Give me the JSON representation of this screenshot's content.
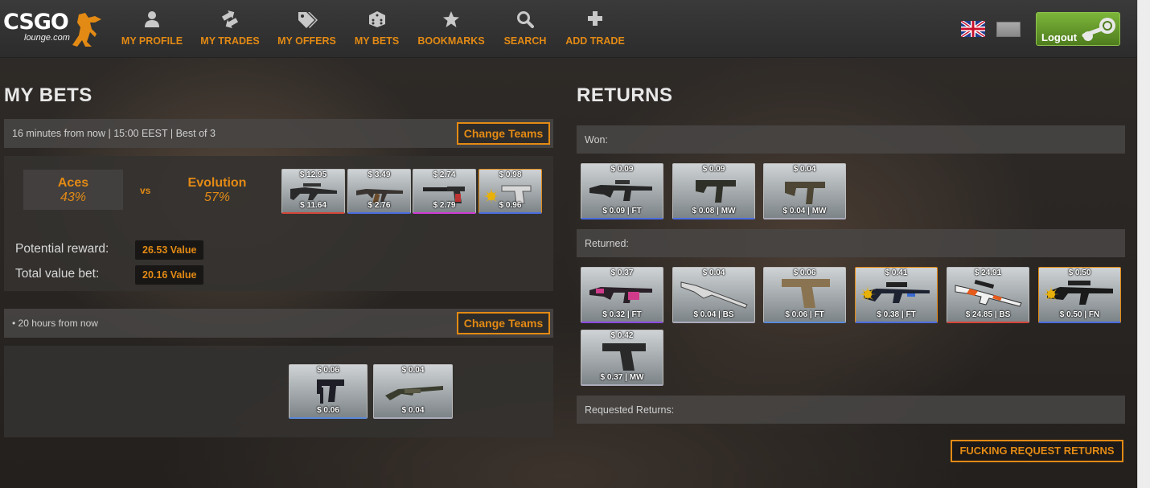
{
  "logo": {
    "main": "CSGO",
    "sub": "lounge.com"
  },
  "nav": [
    {
      "label": "MY PROFILE",
      "icon": "user-icon"
    },
    {
      "label": "MY TRADES",
      "icon": "trades-icon"
    },
    {
      "label": "MY OFFERS",
      "icon": "tags-icon"
    },
    {
      "label": "MY BETS",
      "icon": "dice-icon"
    },
    {
      "label": "BOOKMARKS",
      "icon": "star-icon"
    },
    {
      "label": "SEARCH",
      "icon": "search-icon"
    },
    {
      "label": "ADD TRADE",
      "icon": "plus-icon"
    }
  ],
  "logout_label": "Logout",
  "my_bets": {
    "title": "MY BETS",
    "bet1": {
      "info": "16 minutes from now | 15:00 EEST | Best of 3",
      "change_teams": "Change Teams",
      "team1": {
        "name": "Aces",
        "percent": "43%"
      },
      "vs": "vs",
      "team2": {
        "name": "Evolution",
        "percent": "57%"
      },
      "items": [
        {
          "top": "$ 12.95",
          "bottom": "$ 11.64",
          "rarity": "#d4463a",
          "icon": "rifle-scope-icon"
        },
        {
          "top": "$ 3.49",
          "bottom": "$ 2.76",
          "rarity": "#4a6ce0",
          "icon": "ak-icon"
        },
        {
          "top": "$ 2.74",
          "bottom": "$ 2.79",
          "rarity": "#d03ad4",
          "icon": "pistol-silenced-icon"
        },
        {
          "top": "$ 0.98",
          "bottom": "$ 0.96",
          "rarity": "#4a6ce0",
          "icon": "pistol-icon"
        }
      ],
      "potential_label": "Potential reward:",
      "potential_value": "26.53 Value",
      "total_label": "Total value bet:",
      "total_value": "20.16 Value"
    },
    "bet2": {
      "info": "• 20 hours from now",
      "change_teams": "Change Teams",
      "items": [
        {
          "top": "$ 0.06",
          "bottom": "$ 0.06",
          "icon": "smg-icon"
        },
        {
          "top": "$ 0.04",
          "bottom": "$ 0.04",
          "icon": "shotgun-icon"
        }
      ]
    }
  },
  "returns": {
    "title": "RETURNS",
    "won_label": "Won:",
    "won_items": [
      {
        "top": "$ 0.09",
        "bottom": "$ 0.09 | FT",
        "icon": "rifle-icon"
      },
      {
        "top": "$ 0.09",
        "bottom": "$ 0.08 | MW",
        "icon": "smg-icon"
      },
      {
        "top": "$ 0.04",
        "bottom": "$ 0.04 | MW",
        "icon": "smg-icon"
      }
    ],
    "returned_label": "Returned:",
    "returned_items": [
      {
        "top": "$ 0.37",
        "bottom": "$ 0.32 | FT",
        "icon": "rifle-icon"
      },
      {
        "top": "$ 0.04",
        "bottom": "$ 0.04 | BS",
        "icon": "shotgun-icon"
      },
      {
        "top": "$ 0.06",
        "bottom": "$ 0.06 | FT",
        "icon": "deagle-icon"
      },
      {
        "top": "$ 0.41",
        "bottom": "$ 0.38 | FT",
        "icon": "sniper-icon"
      },
      {
        "top": "$ 24.91",
        "bottom": "$ 24.85 | BS",
        "icon": "awp-icon"
      },
      {
        "top": "$ 0.50",
        "bottom": "$ 0.50 | FN",
        "icon": "sniper-icon"
      },
      {
        "top": "$ 0.42",
        "bottom": "$ 0.37 | MW",
        "icon": "pistol-icon"
      }
    ],
    "requested_label": "Requested Returns:",
    "request_button": "FUCKING REQUEST RETURNS"
  }
}
